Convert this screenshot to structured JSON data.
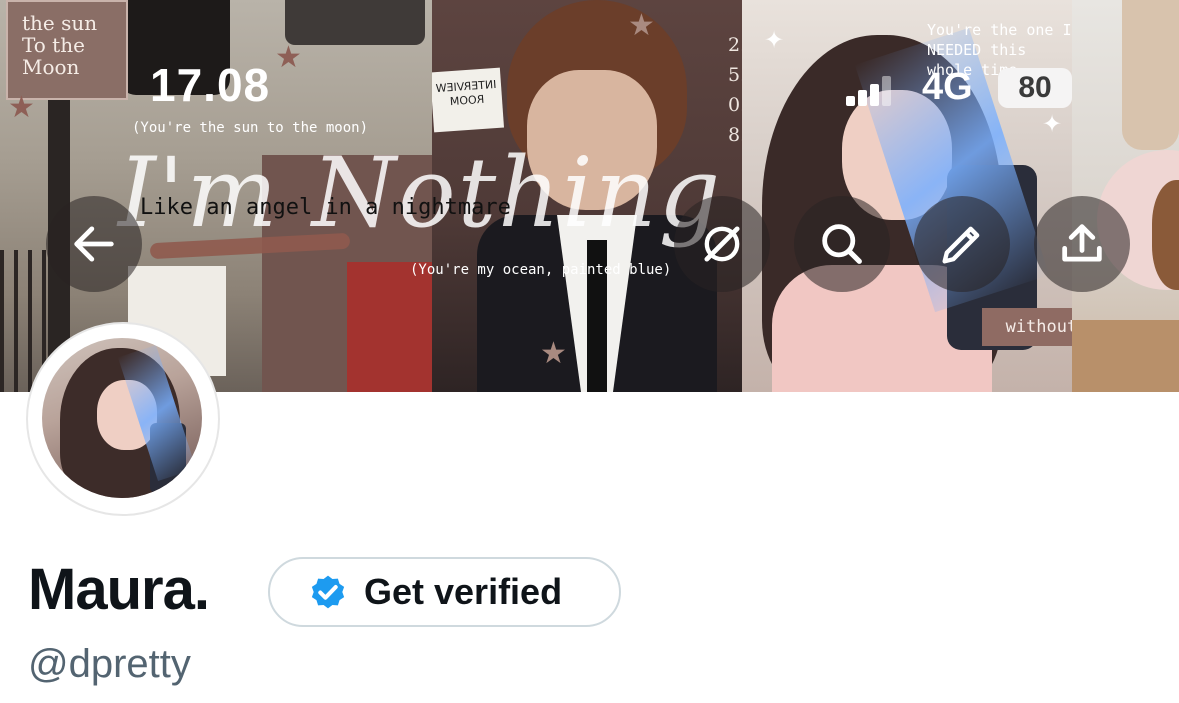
{
  "status_bar": {
    "time": "17.08",
    "network": "4G",
    "battery": "80"
  },
  "header": {
    "tag_text": "the sun To the Moon",
    "big_script": "I'm Nothing",
    "script_line": "Like an angel in a nightmare",
    "caption_top": "(You're the sun to the moon)",
    "caption_mid": "(You're my ocean, painted blue)",
    "quote": "You're the one I NEEDED this whole time",
    "without_tag": "without you!",
    "room_sign": "INTERVIEW ROOM",
    "numbers": [
      "2.",
      "5.",
      "0.",
      "8."
    ]
  },
  "nav": {
    "back_icon": "arrow-left-icon",
    "grok_icon": "grok-icon",
    "search_icon": "search-icon",
    "edit_icon": "pencil-icon",
    "share_icon": "share-icon"
  },
  "profile": {
    "display_name": "Maura.",
    "verify_label": "Get verified",
    "handle": "@dpretty"
  },
  "colors": {
    "verified_blue": "#1d9bf0",
    "text_primary": "#0f1419",
    "text_secondary": "#536471",
    "border": "#cfd9de"
  }
}
